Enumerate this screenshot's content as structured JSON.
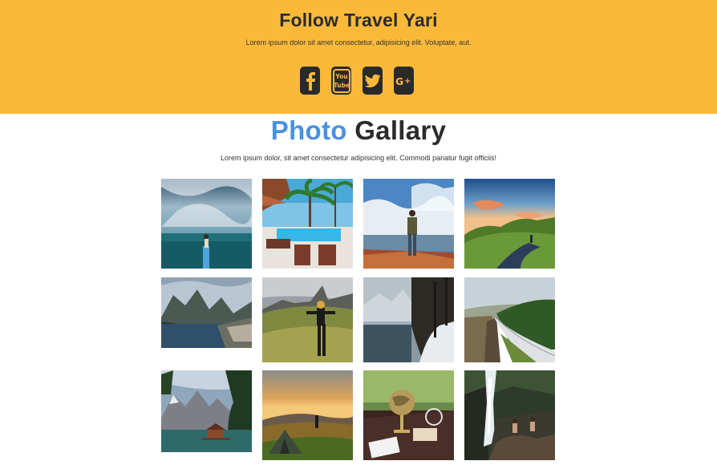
{
  "follow": {
    "title": "Follow Travel Yari",
    "subtitle": "Lorem ipsum dolor sit amet consectetur, adipisicing elit. Voluptate, aut.",
    "social": [
      {
        "icon": "facebook-icon",
        "label": "f"
      },
      {
        "icon": "youtube-icon",
        "label": "You Tube"
      },
      {
        "icon": "twitter-icon",
        "label": ""
      },
      {
        "icon": "google-plus-icon",
        "label": "G+"
      }
    ]
  },
  "gallery": {
    "title_accent": "Photo",
    "title_rest": "Gallary",
    "subtitle": "Lorem ipsum dolor, sit amet consectetur adipisicing elit. Commodi pariatur fugit officiis!",
    "photos": [
      {
        "name": "photo-paddleboard-ocean"
      },
      {
        "name": "photo-tropical-pool"
      },
      {
        "name": "photo-hiker-cliff"
      },
      {
        "name": "photo-sunset-hills"
      },
      {
        "name": "photo-mountain-fjord"
      },
      {
        "name": "photo-person-mountain-field"
      },
      {
        "name": "photo-snowy-forest-lake"
      },
      {
        "name": "photo-valley-road"
      },
      {
        "name": "photo-lake-cabin-mountains"
      },
      {
        "name": "photo-tent-sunset"
      },
      {
        "name": "photo-globe-desk"
      },
      {
        "name": "photo-waterfall"
      }
    ]
  },
  "colors": {
    "banner": "#fbb93a",
    "accent": "#4a90e2",
    "icon_bg": "#2a2a2a"
  }
}
